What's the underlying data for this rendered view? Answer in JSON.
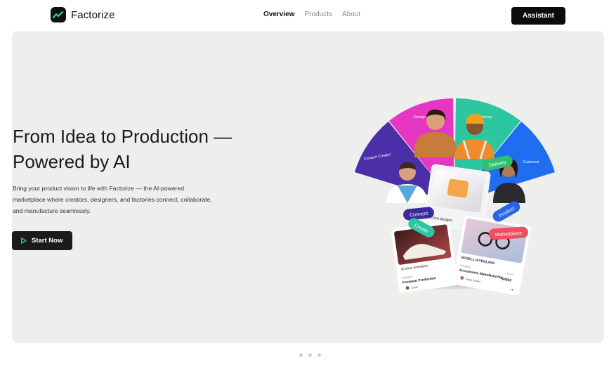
{
  "header": {
    "brand": "Factorize",
    "nav": [
      {
        "label": "Overview",
        "active": true
      },
      {
        "label": "Products",
        "active": false
      },
      {
        "label": "About",
        "active": false
      }
    ],
    "assistant_label": "Assistant"
  },
  "hero": {
    "headline_line1": "From Idea to Production —",
    "headline_line2": "Powered by AI",
    "subtext": "Bring your product vision to life with Factorize — the AI-powered marketplace where creators, designers, and factories connect, collaborate, and manufacture seamlessly.",
    "cta_label": "Start Now",
    "wheel_labels": {
      "content_creator": "Content Creator",
      "designer": "Designer",
      "factory": "Factory",
      "customer": "Customer"
    },
    "pills": {
      "delivery": "Delivery",
      "connect": "Connect",
      "create": "Create",
      "product": "Product",
      "marketplace": "Marketplace"
    },
    "cards": {
      "clock": "Clock designs",
      "shoe_title": "3d shoe animation",
      "shoe_category_label": "Category",
      "shoe_category": "Footwear Production",
      "shoe_by": "Smith",
      "glasses_title": "BOZELLI EYEGLASS",
      "glasses_category_label": "Category",
      "glasses_category": "Accessories Manufacturing",
      "glasses_by": "Maria Smiles",
      "glasses_price_label": "Price",
      "glasses_price": "$4300"
    }
  },
  "carousel": {
    "dot_count": 3
  },
  "colors": {
    "wheel_purple": "#4b2fa8",
    "wheel_pink": "#e637c2",
    "wheel_teal": "#2cc6a0",
    "wheel_blue": "#1f6df0",
    "pill_green": "#2fbf71",
    "pill_blue": "#2a64e6",
    "pill_red": "#ee4f5e",
    "pill_navy": "#3b2a9c"
  }
}
